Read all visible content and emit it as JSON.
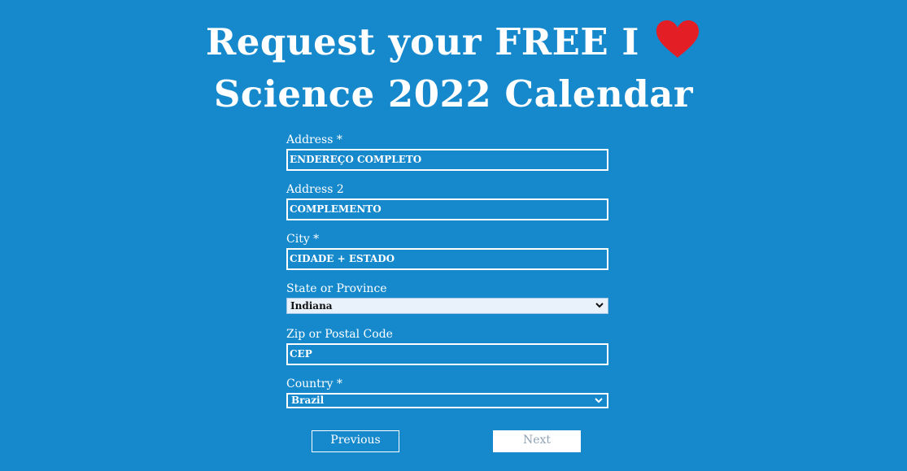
{
  "header": {
    "title_line1": "Request your FREE I",
    "title_line2": "Science 2022 Calendar",
    "heart_icon": "heart-icon",
    "heart_color": "#e31e25"
  },
  "form": {
    "address": {
      "label": "Address *",
      "value": "ENDEREÇO COMPLETO"
    },
    "address2": {
      "label": "Address 2",
      "value": "COMPLEMENTO"
    },
    "city": {
      "label": "City *",
      "value": "CIDADE + ESTADO"
    },
    "state": {
      "label": "State or Province",
      "selected": "Indiana"
    },
    "zip": {
      "label": "Zip or Postal Code",
      "value": "CEP"
    },
    "country": {
      "label": "Country *",
      "selected": "Brazil"
    }
  },
  "buttons": {
    "previous": "Previous",
    "next": "Next"
  },
  "colors": {
    "background": "#1689cd",
    "text": "#ffffff"
  }
}
